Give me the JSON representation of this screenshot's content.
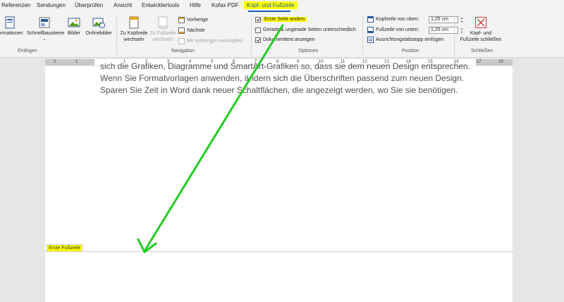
{
  "tabs": [
    "Referenzen",
    "Sendungen",
    "Überprüfen",
    "Ansicht",
    "Entwicklertools",
    "Hilfe",
    "Kofax PDF",
    "Kopf- und Fußzeile"
  ],
  "active_tab": "Kopf- und Fußzeile",
  "colors": {
    "accent": "#185abd",
    "highlight": "#ffff00",
    "arrow": "#22cc22",
    "close": "#d13438"
  },
  "ribbon": {
    "insert": {
      "informationen": "formationen",
      "schnellbausteine": "Schnellbausteine",
      "bilder": "Bilder",
      "onlinebilder": "Onlinebilder",
      "label": "Einfügen"
    },
    "navigation": {
      "zu_kopfzeile": [
        "Zu Kopfzeile",
        "wechseln"
      ],
      "zu_fusszeile": [
        "Zu Fußzeile",
        "wechseln"
      ],
      "vorherige": "Vorherige",
      "naechste": "Nächste",
      "mit_vorheriger": "Mit vorheriger verknüpfen",
      "label": "Navigation"
    },
    "optionen": {
      "erste_seite": "Erste Seite anders",
      "erste_seite_checked": true,
      "gerade_ungerade": "Gerade & ungerade Seiten unterschiedlich",
      "gerade_ungerade_checked": false,
      "dokumenttext": "Dokumenttext anzeigen",
      "dokumenttext_checked": true,
      "label": "Optionen"
    },
    "position": {
      "kopfzeile_label": "Kopfzeile von oben:",
      "kopfzeile_value": "1,25 cm",
      "fusszeile_label": "Fußzeile von unten:",
      "fusszeile_value": "1,25 cm",
      "ausrichtung": "Ausrichtungstabstopp einfügen",
      "label": "Position"
    },
    "schliessen": {
      "button": [
        "Kopf- und",
        "Fußzeile schließen"
      ],
      "label": "Schließen"
    }
  },
  "ruler": [
    "2",
    "1",
    "1",
    "2",
    "3",
    "4",
    "5",
    "6",
    "7",
    "8",
    "9",
    "10",
    "11",
    "12",
    "13",
    "14",
    "15",
    "16",
    "17",
    "18"
  ],
  "document": {
    "lines": [
      "sich die Grafiken, Diagramme und SmartArt-Grafiken so, dass sie dem neuen Design entsprechen.",
      "Wenn Sie Formatvorlagen anwenden, ändern sich die Überschriften passend zum neuen Design.",
      "Sparen Sie Zeit in Word dank neuer Schaltflächen, die angezeigt werden, wo Sie sie benötigen."
    ],
    "footer_tag": "Erste Fußzeile"
  }
}
